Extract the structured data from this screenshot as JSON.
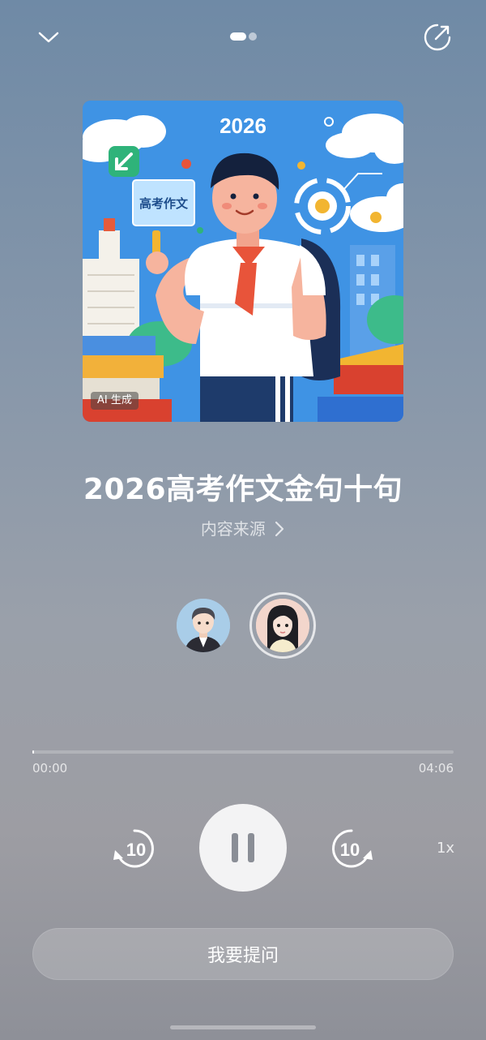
{
  "top_bar": {
    "collapse_icon": "chevron-down-icon",
    "share_icon": "share-icon",
    "page_count": 2,
    "active_page": 1
  },
  "cover": {
    "year_text": "2026",
    "sign_text": "高考作文",
    "badge": "AI 生成"
  },
  "episode": {
    "title": "2026高考作文金句十句",
    "source_label": "内容来源",
    "source_chevron": "›"
  },
  "hosts": [
    {
      "name": "male-host-avatar"
    },
    {
      "name": "female-host-avatar",
      "active": true
    }
  ],
  "player": {
    "current_time": "00:00",
    "total_time": "04:06",
    "progress_fraction": 0.0,
    "rewind_label": "10",
    "forward_label": "10",
    "speed_label": "1x",
    "state": "playing"
  },
  "ask": {
    "label": "我要提问"
  },
  "colors": {
    "accent": "#ffffff",
    "cover_sky": "#3d8fe0"
  }
}
